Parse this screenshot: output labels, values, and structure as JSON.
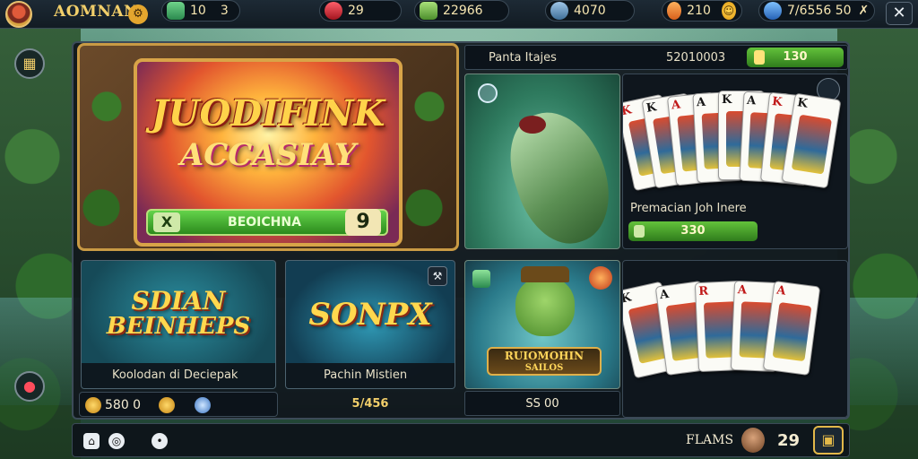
{
  "top_bar": {
    "player_name": "AOMNAN",
    "settings_glyph": "⚙",
    "gems_value": "10",
    "gems_arrow": "3",
    "rubies_value": "29",
    "cash_value": "22966",
    "boy_value": "4070",
    "orange_value": "210",
    "shield_value": "7/6556 50",
    "shield_arrow": "✗",
    "close_glyph": "✕"
  },
  "featured": {
    "title": "JUODIFINK",
    "subtitle": "ACCASIAY",
    "bar_small_label": "",
    "bar_x": "X",
    "bar_label": "BEOICHNA",
    "bar_number": "9"
  },
  "header_row": {
    "left_text": "Panta Itajes",
    "mid_text": "52010003",
    "button_text": "130"
  },
  "cards_panel_1": {
    "label": "Premacian Joh Inere",
    "button_text": "330",
    "cards": [
      {
        "rank": "K",
        "color": "red"
      },
      {
        "rank": "K",
        "color": "black"
      },
      {
        "rank": "A",
        "color": "red"
      },
      {
        "rank": "A",
        "color": "black"
      },
      {
        "rank": "K",
        "color": "black"
      },
      {
        "rank": "A",
        "color": "black"
      },
      {
        "rank": "K",
        "color": "red"
      },
      {
        "rank": "K",
        "color": "black"
      }
    ]
  },
  "tile_a": {
    "title_line1": "SDIAN",
    "title_line2": "BEINHEPS",
    "footer": "Koolodan di Deciepak"
  },
  "tile_b": {
    "title": "SONPX",
    "footer": "Pachin Mistien"
  },
  "stat_row": {
    "value": "580 0"
  },
  "tile_b_small": "5/456",
  "frog_tile": {
    "banner_line1": "RUIOMOHIN",
    "banner_line2": "SAILOS",
    "footer": "SS 00"
  },
  "cards_panel_2": {
    "cards": [
      {
        "rank": "K",
        "color": "black"
      },
      {
        "rank": "A",
        "color": "black"
      },
      {
        "rank": "R",
        "color": "red"
      },
      {
        "rank": "A",
        "color": "red"
      },
      {
        "rank": "A",
        "color": "red"
      }
    ]
  },
  "bottom_bar": {
    "label": "FLAMS",
    "number": "29"
  }
}
